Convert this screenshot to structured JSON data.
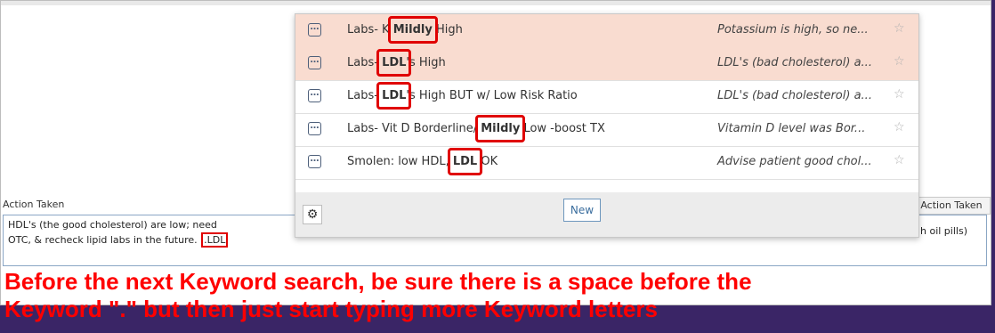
{
  "panel": {
    "action_label": "Action Taken",
    "action_label_right": "Action Taken",
    "text_line1": "HDL's (the good cholesterol) are low;  need",
    "text_line2": "OTC, & recheck lipid labs in the future. ",
    "typed": ".LDL",
    "text_tail": "h oil pills)"
  },
  "dropdown": {
    "rows": [
      {
        "pre": "Labs- K ",
        "mark": "Mildly",
        "post": " High",
        "desc": "Potassium is high, so ne...",
        "highlighted": true
      },
      {
        "pre": "Labs- ",
        "mark": "LDL",
        "post": "'s High",
        "desc": "LDL's (bad cholesterol) a...",
        "highlighted": true
      },
      {
        "pre": "Labs- ",
        "mark": "LDL",
        "post": "'s High BUT w/ Low Risk Ratio",
        "desc": "LDL's (bad cholesterol) a...",
        "highlighted": false
      },
      {
        "pre": "Labs- Vit D Borderline/ ",
        "mark": "Mildly",
        "post": " Low -boost TX",
        "desc": "Vitamin D level was Bor...",
        "highlighted": false
      },
      {
        "pre": "Smolen: low HDL, ",
        "mark": "LDL",
        "post": " OK",
        "desc": "Advise patient good chol...",
        "highlighted": false
      }
    ],
    "new_label": "New",
    "icons": {
      "gear": "gear-icon",
      "ellipsis": "ellipsis-icon",
      "star": "star-icon"
    }
  },
  "instructions": {
    "line1": "Before the next Keyword search, be sure there is a space before the",
    "line2": "Keyword \".\" but then just start typing more Keyword letters"
  },
  "colors": {
    "highlight": "#f9dcd0",
    "annotation": "#ff0000",
    "background": "#3a2566"
  }
}
